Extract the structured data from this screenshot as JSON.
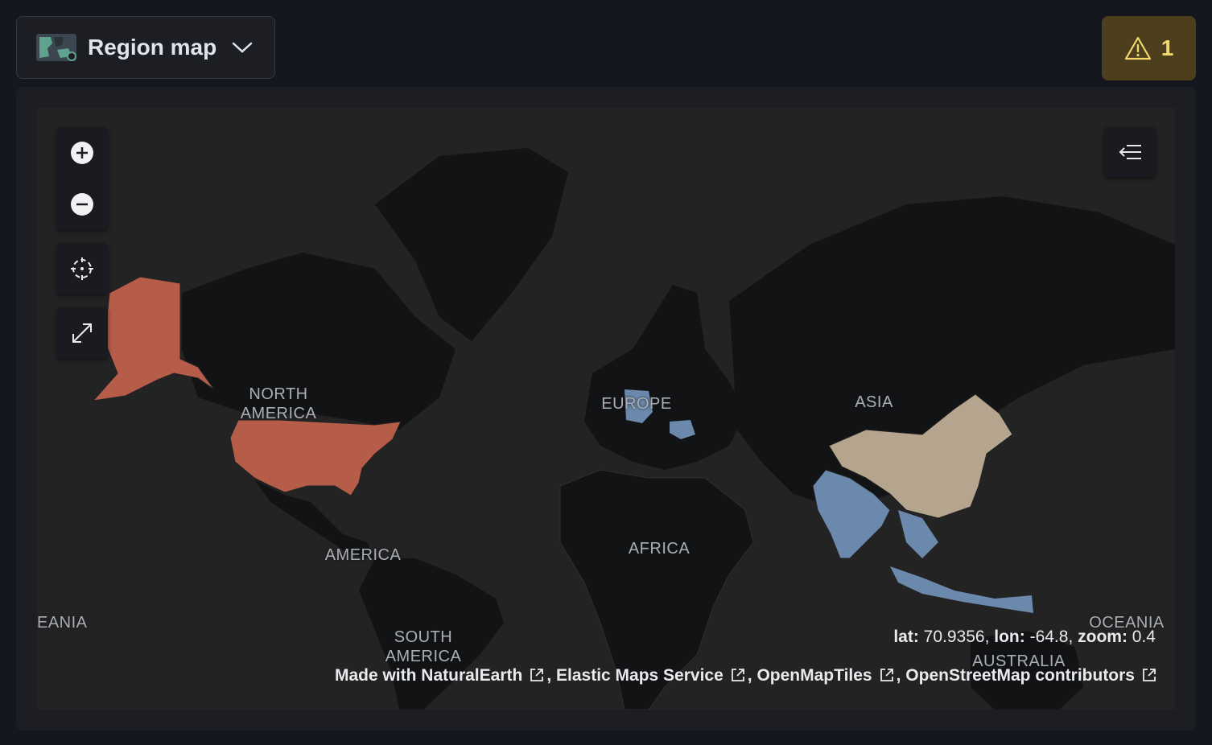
{
  "header": {
    "viz_type_label": "Region map",
    "warning_count": "1"
  },
  "map": {
    "labels": {
      "north_america": "NORTH\nAMERICA",
      "europe": "EUROPE",
      "asia": "ASIA",
      "africa": "AFRICA",
      "america": "AMERICA",
      "south_america": "SOUTH\nAMERICA",
      "oceania_left": "EANIA",
      "oceania_right": "OCEANIA",
      "australia": "AUSTRALIA"
    },
    "coords": {
      "lat_label": "lat:",
      "lat_value": "70.9356",
      "lon_label": "lon:",
      "lon_value": "-64.8",
      "zoom_label": "zoom:",
      "zoom_value": "0.4"
    },
    "attribution": [
      "Made with NaturalEarth",
      "Elastic Maps Service",
      "OpenMapTiles",
      "OpenStreetMap contributors"
    ],
    "colors": {
      "high": "#b55d49",
      "mid": "#b6a58e",
      "low": "#6a89ac",
      "land": "#121315",
      "water": "#232323"
    }
  }
}
